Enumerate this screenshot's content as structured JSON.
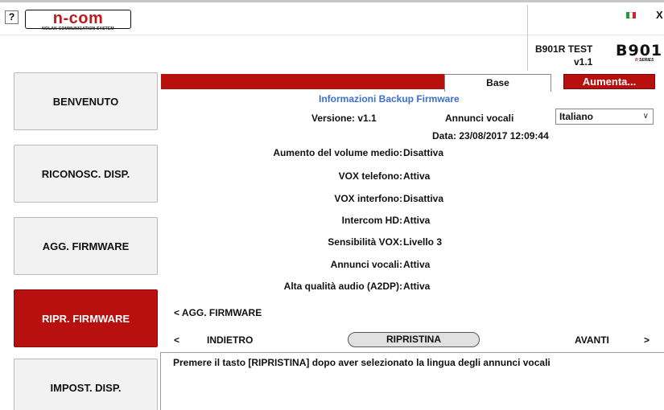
{
  "header": {
    "help_label": "?",
    "logo_text": "n-com",
    "logo_subtext": "NOLAN COMMUNICATION SYSTEM",
    "close_label": "X",
    "device_name": "B901R TEST",
    "device_version": "v1.1",
    "brand_logo_text": "B901",
    "brand_logo_sub_letter": "R",
    "brand_logo_sub": "SERIES",
    "flag_colors": [
      "#1f9d3a",
      "#ffffff",
      "#d3222a"
    ]
  },
  "sidebar": {
    "items": [
      {
        "label": "BENVENUTO",
        "active": false
      },
      {
        "label": "RICONOSC. DISP.",
        "active": false
      },
      {
        "label": "AGG. FIRMWARE",
        "active": false
      },
      {
        "label": "RIPR. FIRMWARE",
        "active": true
      },
      {
        "label": "IMPOST. DISP.",
        "active": false
      }
    ]
  },
  "tabs": {
    "base": "Base",
    "aumenta": "Aumenta..."
  },
  "main": {
    "title": "Informazioni Backup Firmware",
    "version_label": "Versione: v1.1",
    "voice_label": "Annunci vocali",
    "voice_select_value": "Italiano",
    "date_label": "Data:  23/08/2017 12:09:44",
    "settings": [
      {
        "label": "Aumento del volume medio:",
        "value": "Disattiva"
      },
      {
        "label": "VOX telefono:",
        "value": "Attiva"
      },
      {
        "label": "VOX interfono:",
        "value": "Disattiva"
      },
      {
        "label": "Intercom HD:",
        "value": "Attiva"
      },
      {
        "label": "Sensibilità VOX:",
        "value": "Livello 3"
      },
      {
        "label": "Annunci vocali:",
        "value": "Attiva"
      },
      {
        "label": "Alta qualità audio (A2DP):",
        "value": "Attiva"
      }
    ],
    "back_link": "< AGG. FIRMWARE"
  },
  "nav": {
    "prev_arrow": "<",
    "prev_label": "INDIETRO",
    "restore_label": "RIPRISTINA",
    "next_label": "AVANTI",
    "next_arrow": ">"
  },
  "message": "Premere il tasto [RIPRISTINA] dopo aver selezionato la  lingua degli annunci vocali",
  "colors": {
    "accent_red": "#b80f0f",
    "title_blue": "#3a6fcf"
  }
}
